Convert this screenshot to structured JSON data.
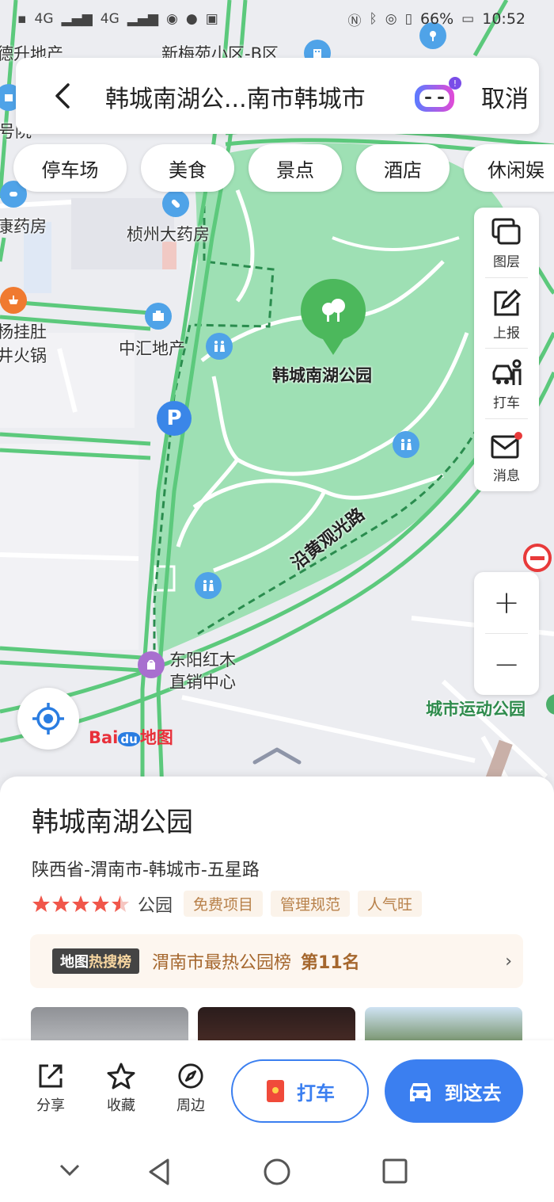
{
  "status_bar": {
    "network_1": "4G",
    "network_2": "4G",
    "battery": "66%",
    "time": "10:52"
  },
  "map": {
    "labels": {
      "desheng": "德升地产",
      "xinmeiyuan": "新梅苑小区-B区",
      "kangyaofang": "康药房",
      "zhenzhou_pharmacy": "桢州大药房",
      "yangguadu": "杨挂肚",
      "huoguo": "井火锅",
      "zhonghui": "中汇地产",
      "park_name": "韩城南湖公园",
      "road": "沿黄观光路",
      "dongyang_1": "东阳红木",
      "dongyang_2": "直销中心",
      "sports_park": "城市运动公园",
      "hao": "号院",
      "parking_letter": "P"
    },
    "park_color": "#9ee0b4",
    "road_color": "#5cc97c"
  },
  "search": {
    "query": "韩城南湖公...南市韩城市",
    "cancel_label": "取消"
  },
  "chips": [
    "停车场",
    "美食",
    "景点",
    "酒店",
    "休闲娱"
  ],
  "toolbar": {
    "layers": "图层",
    "report": "上报",
    "taxi": "打车",
    "messages": "消息"
  },
  "zoom": {
    "plus": "+",
    "minus": "−"
  },
  "logo": {
    "bai": "Bai",
    "du": "du",
    "ditu": "地图"
  },
  "place": {
    "name": "韩城南湖公园",
    "address": "陕西省-渭南市-韩城市-五星路",
    "rating": 4.5,
    "category": "公园",
    "tags": [
      "免费项目",
      "管理规范",
      "人气旺"
    ]
  },
  "rank": {
    "badge_a": "地图",
    "badge_b": "热搜榜",
    "text": "渭南市最热公园榜",
    "position": "第11名"
  },
  "actions": {
    "share": "分享",
    "favorite": "收藏",
    "nearby": "周边",
    "taxi": "打车",
    "go": "到这去"
  },
  "colors": {
    "accent": "#3b7ff0",
    "star": "#f0564a",
    "tag_text": "#b8814a"
  }
}
